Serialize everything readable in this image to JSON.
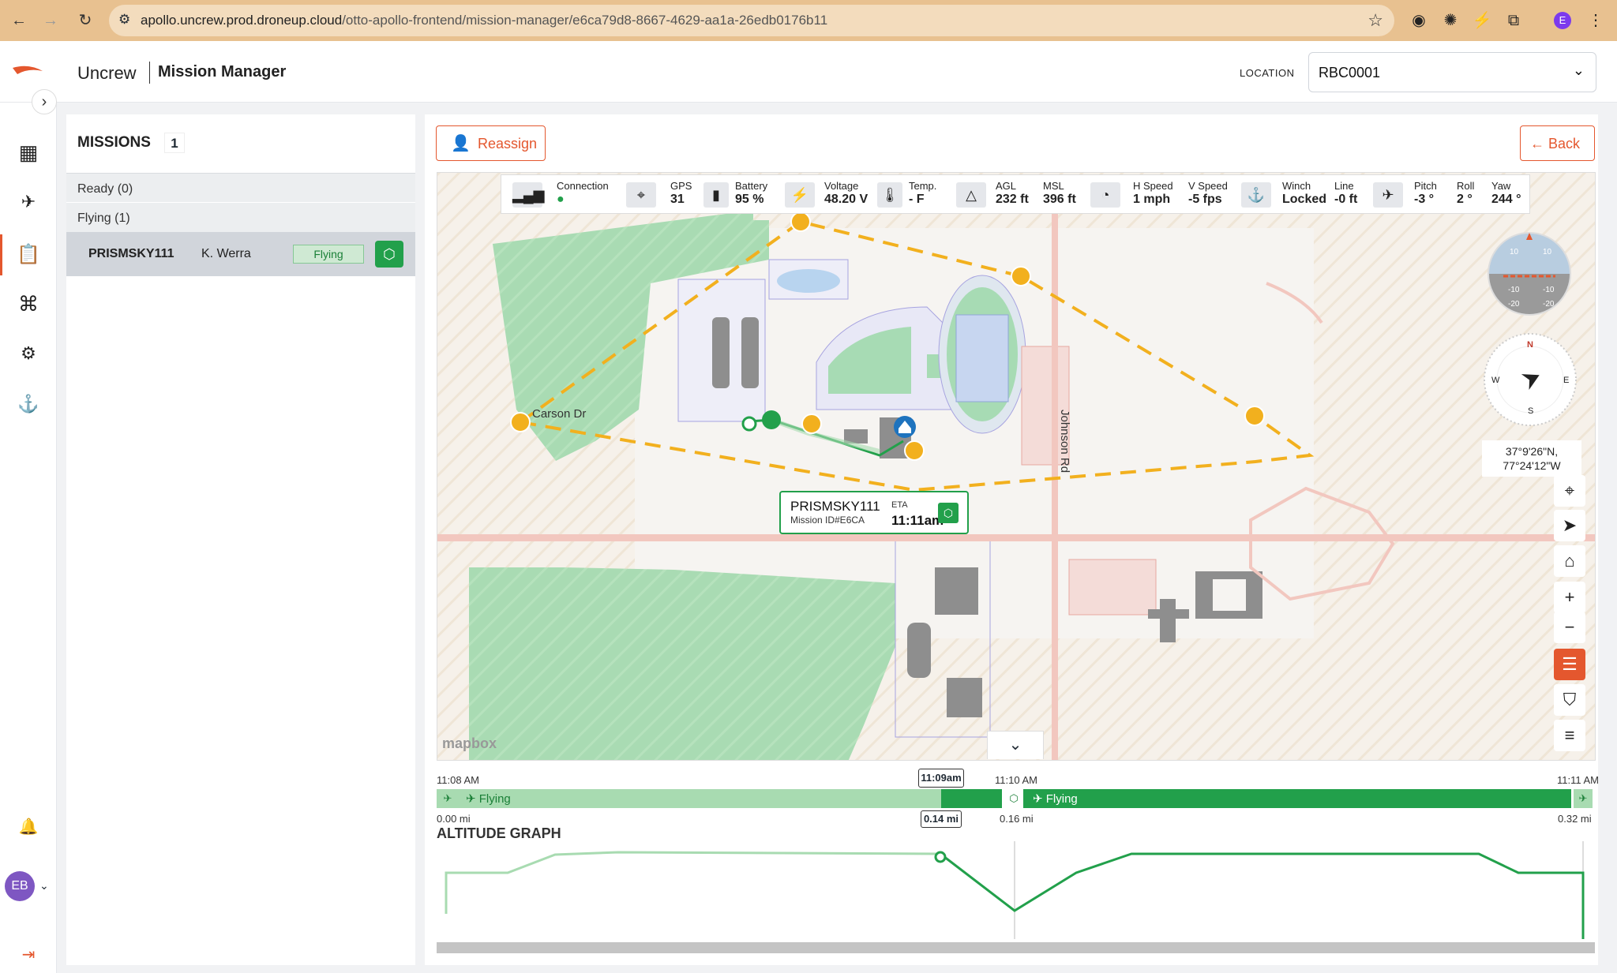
{
  "browser": {
    "url_domain": "apollo.uncrew.prod.droneup.cloud",
    "url_path": "/otto-apollo-frontend/mission-manager/e6ca79d8-8667-4629-aa1a-26edb0176b11",
    "profile_initial": "E"
  },
  "header": {
    "brand": "Uncrew",
    "title": "Mission Manager",
    "location_label": "LOCATION",
    "location_value": "RBC0001"
  },
  "sidebar": {
    "user_initials": "EB"
  },
  "missions": {
    "heading": "MISSIONS",
    "count": "1",
    "groups": [
      {
        "label": "Ready (0)"
      },
      {
        "label": "Flying (1)"
      }
    ],
    "rows": [
      {
        "name": "PRISMSKY111",
        "pilot": "K. Werra",
        "status": "Flying"
      }
    ]
  },
  "actions": {
    "reassign": "Reassign",
    "back": "← Back"
  },
  "telemetry": [
    {
      "label": "Connection",
      "value": "●"
    },
    {
      "label": "GPS",
      "value": "31"
    },
    {
      "label": "Battery",
      "value": "95 %"
    },
    {
      "label": "Voltage",
      "value": "48.20 V"
    },
    {
      "label": "Temp.",
      "value": "- F"
    },
    {
      "label": "AGL",
      "value": "232 ft"
    },
    {
      "label": "MSL",
      "value": "396 ft"
    },
    {
      "label": "H Speed",
      "value": "1 mph"
    },
    {
      "label": "V Speed",
      "value": "-5 fps"
    },
    {
      "label": "Winch",
      "value": "Locked"
    },
    {
      "label": "Line",
      "value": "-0 ft"
    },
    {
      "label": "Pitch",
      "value": "-3 °"
    },
    {
      "label": "Roll",
      "value": "2 °"
    },
    {
      "label": "Yaw",
      "value": "244 °"
    }
  ],
  "map": {
    "street_1": "Carson Dr",
    "street_2": "Johnson Rd",
    "attribution": "mapbox",
    "coords_line1": "37°9'26\"N,",
    "coords_line2": "77°24'12\"W",
    "compass": {
      "n": "N",
      "e": "E",
      "s": "S",
      "w": "W"
    },
    "attitude_ticks": [
      "10",
      "10",
      "-10",
      "-10",
      "-20",
      "-20"
    ],
    "callout": {
      "name": "PRISMSKY111",
      "mission_id": "Mission ID#E6CA",
      "eta_label": "ETA",
      "eta_value": "11:11am"
    }
  },
  "timeline": {
    "time_start": "11:08 AM",
    "time_mid": "11:10 AM",
    "time_end": "11:11 AM",
    "cursor_time": "11:09am",
    "cursor_dist": "0.14 mi",
    "dist_start": "0.00 mi",
    "dist_mid": "0.16 mi",
    "dist_end": "0.32 mi",
    "segment_1": "Flying",
    "segment_2": "Flying",
    "altitude_title": "ALTITUDE GRAPH"
  },
  "colors": {
    "accent": "#e4572e",
    "flying_green": "#22a04b",
    "light_green": "#a8dbb1",
    "route_orange": "#f2b01e"
  }
}
